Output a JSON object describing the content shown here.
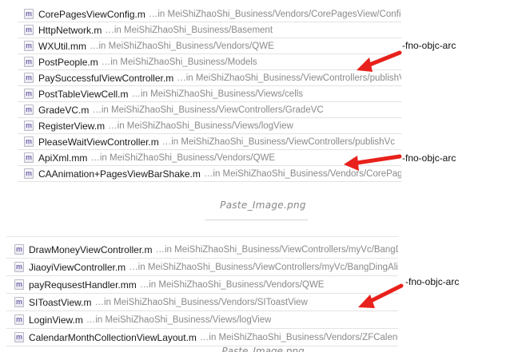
{
  "panel_top": {
    "rows": [
      {
        "name": "CorePagesViewConfig.m",
        "path": "…in MeiShiZhaoShi_Business/Vendors/CorePagesView/Config"
      },
      {
        "name": "HttpNetwork.m",
        "path": "…in MeiShiZhaoShi_Business/Basement"
      },
      {
        "name": "WXUtil.mm",
        "path": "…in MeiShiZhaoShi_Business/Vendors/QWE"
      },
      {
        "name": "PostPeople.m",
        "path": "…in MeiShiZhaoShi_Business/Models"
      },
      {
        "name": "PaySuccessfulViewController.m",
        "path": "…in MeiShiZhaoShi_Business/ViewControllers/publishVc"
      },
      {
        "name": "PostTableViewCell.m",
        "path": "…in MeiShiZhaoShi_Business/Views/cells"
      },
      {
        "name": "GradeVC.m",
        "path": "…in MeiShiZhaoShi_Business/ViewControllers/GradeVC"
      },
      {
        "name": "RegisterView.m",
        "path": "…in MeiShiZhaoShi_Business/Views/logView"
      },
      {
        "name": "PleaseWaitViewController.m",
        "path": "…in MeiShiZhaoShi_Business/ViewControllers/publishVc"
      },
      {
        "name": "ApiXml.mm",
        "path": "…in MeiShiZhaoShi_Business/Vendors/QWE"
      },
      {
        "name": "CAAnimation+PagesViewBarShake.m",
        "path": "…in MeiShiZhaoShi_Business/Vendors/CorePagesVi…"
      }
    ]
  },
  "caption_1": "Paste_Image.png",
  "panel_bottom": {
    "rows": [
      {
        "name": "DrawMoneyViewController.m",
        "path": "…in MeiShiZhaoShi_Business/ViewControllers/myVc/BangDin…"
      },
      {
        "name": "JiaoyiViewController.m",
        "path": "…in MeiShiZhaoShi_Business/ViewControllers/myVc/BangDingAliP…"
      },
      {
        "name": "payRequsestHandler.mm",
        "path": "…in MeiShiZhaoShi_Business/Vendors/QWE"
      },
      {
        "name": "SIToastView.m",
        "path": "…in MeiShiZhaoShi_Business/Vendors/SIToastView"
      },
      {
        "name": "LoginView.m",
        "path": "…in MeiShiZhaoShi_Business/Views/logView"
      },
      {
        "name": "CalendarMonthCollectionViewLayout.m",
        "path": "…in MeiShiZhaoShi_Business/Vendors/ZFCalendar"
      }
    ]
  },
  "caption_2": "Paste_Image.png",
  "annotations": [
    "-fno-objc-arc",
    "-fno-objc-arc",
    "-fno-objc-arc"
  ],
  "file_icon_glyph": "m",
  "colors": {
    "arrow": "#e8211c",
    "path_text": "#8a8a8a",
    "file_icon": "#7a6bb0"
  }
}
